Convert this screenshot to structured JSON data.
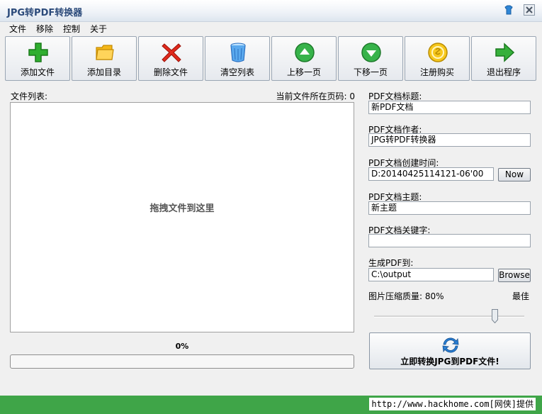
{
  "window": {
    "title": "JPG转PDF转换器"
  },
  "menu": [
    "文件",
    "移除",
    "控制",
    "关于"
  ],
  "toolbar": [
    {
      "label": "添加文件",
      "icon": "add-plus-icon"
    },
    {
      "label": "添加目录",
      "icon": "folder-icon"
    },
    {
      "label": "删除文件",
      "icon": "delete-x-icon"
    },
    {
      "label": "清空列表",
      "icon": "trash-bin-icon"
    },
    {
      "label": "上移一页",
      "icon": "arrow-up-icon"
    },
    {
      "label": "下移一页",
      "icon": "arrow-down-icon"
    },
    {
      "label": "注册购买",
      "icon": "coin-icon"
    },
    {
      "label": "退出程序",
      "icon": "exit-arrow-icon"
    }
  ],
  "file_list": {
    "label": "文件列表:",
    "page_label": "当前文件所在页码: 0",
    "drop_hint": "拖拽文件到这里"
  },
  "progress": {
    "text": "0%",
    "value": 0
  },
  "pdf": {
    "title_label": "PDF文档标题:",
    "title_value": "新PDF文档",
    "author_label": "PDF文档作者:",
    "author_value": "JPG转PDF转换器",
    "created_label": "PDF文档创建时间:",
    "created_value": "D:20140425114121-06'00",
    "now_button": "Now",
    "subject_label": "PDF文档主题:",
    "subject_value": "新主题",
    "keywords_label": "PDF文档关键字:",
    "keywords_value": "",
    "output_label": "生成PDF到:",
    "output_value": "C:\\output",
    "browse_button": "Browse",
    "quality_label": "图片压缩质量: 80%",
    "quality_best": "最佳",
    "quality_value": 80
  },
  "convert_button": "立即转换JPG到PDF文件!",
  "status": {
    "text": "http://www.hackhome.com[网侠]提供"
  },
  "colors": {
    "status_green": "#3fa548",
    "title_blue": "#2b4a7a"
  }
}
